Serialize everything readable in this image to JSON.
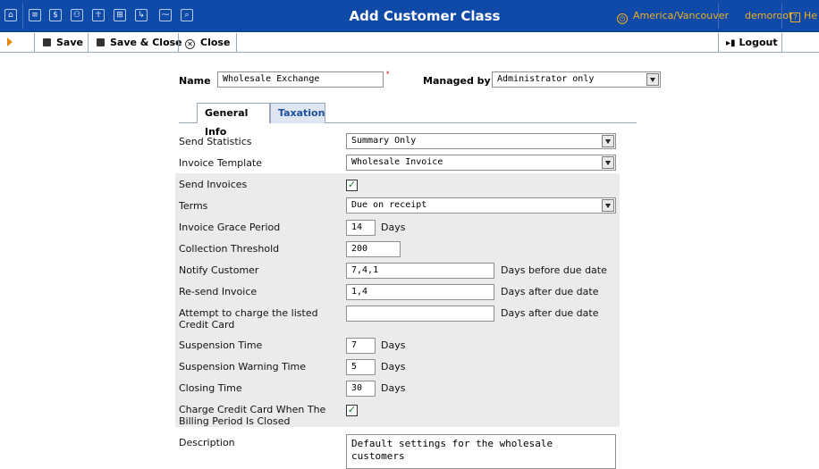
{
  "topbar": {
    "title": "Add Customer Class",
    "timezone": "America/Vancouver",
    "user": "demoroot",
    "help": "He",
    "colors": {
      "bar": "#0f4aa8",
      "accent": "#f0b020"
    },
    "nav_icons": [
      "home-icon",
      "list-icon",
      "dollar-icon",
      "people-icon",
      "person-icon",
      "tree-icon",
      "transfer-icon",
      "chart-icon",
      "search-icon"
    ],
    "nav_glyphs": [
      "⌂",
      "≡",
      "$",
      "⚇",
      "☥",
      "⊞",
      "↳",
      "⁓",
      "⌕"
    ]
  },
  "toolbar": {
    "save": "Save",
    "save_close": "Save & Close",
    "close": "Close",
    "logout": "Logout"
  },
  "form": {
    "name_label": "Name",
    "name_value": "Wholesale Exchange",
    "required_mark": "*",
    "managed_by_label": "Managed by",
    "managed_by_value": "Administrator only"
  },
  "tabs": [
    "General Info",
    "Taxation"
  ],
  "fields": {
    "send_statistics": {
      "label": "Send Statistics",
      "value": "Summary Only"
    },
    "invoice_template": {
      "label": "Invoice Template",
      "value": "Wholesale Invoice"
    },
    "send_invoices": {
      "label": "Send Invoices",
      "checked": "✓"
    },
    "terms": {
      "label": "Terms",
      "value": "Due on receipt"
    },
    "invoice_grace_period": {
      "label": "Invoice Grace Period",
      "value": "14",
      "unit": "Days"
    },
    "collection_threshold": {
      "label": "Collection Threshold",
      "value": "200"
    },
    "notify_customer": {
      "label": "Notify Customer",
      "value": "7,4,1",
      "unit": "Days before due date"
    },
    "resend_invoice": {
      "label": "Re-send Invoice",
      "value": "1,4",
      "unit": "Days after due date"
    },
    "attempt_charge": {
      "label": "Attempt to charge the listed Credit Card",
      "value": "",
      "unit": "Days after due date"
    },
    "suspension_time": {
      "label": "Suspension Time",
      "value": "7",
      "unit": "Days"
    },
    "suspension_warning_time": {
      "label": "Suspension Warning Time",
      "value": "5",
      "unit": "Days"
    },
    "closing_time": {
      "label": "Closing Time",
      "value": "30",
      "unit": "Days"
    },
    "charge_cc_closed": {
      "label": "Charge Credit Card When The Billing Period Is Closed",
      "checked": "✓"
    },
    "description": {
      "label": "Description",
      "value": "Default settings for the wholesale customers"
    }
  }
}
